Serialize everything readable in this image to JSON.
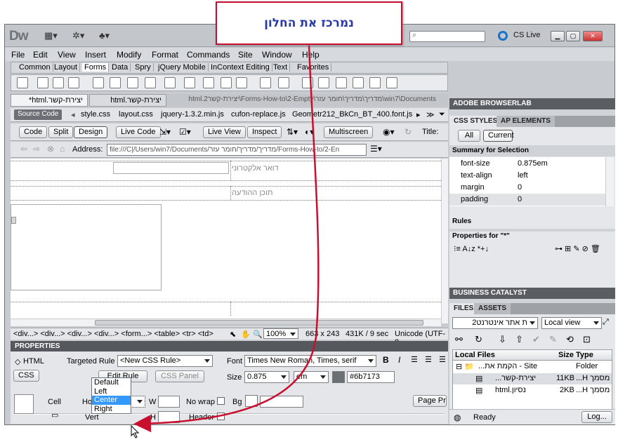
{
  "callout": {
    "text": "נמרכז את החלון"
  },
  "app": {
    "logo": "Dw",
    "cs_live": "CS Live"
  },
  "menu": [
    "File",
    "Edit",
    "View",
    "Insert",
    "Modify",
    "Format",
    "Commands",
    "Site",
    "Window",
    "Help"
  ],
  "insert_tabs": [
    {
      "label": "Common",
      "active": false
    },
    {
      "label": "Layout",
      "active": false
    },
    {
      "label": "Forms",
      "active": true
    },
    {
      "label": "Data",
      "active": false
    },
    {
      "label": "Spry",
      "active": false
    },
    {
      "label": "jQuery Mobile",
      "active": false
    },
    {
      "label": "InContext Editing",
      "active": false
    },
    {
      "label": "Text",
      "active": false
    },
    {
      "label": "Favorites",
      "active": false
    }
  ],
  "doc_tabs": [
    {
      "label": "יצירת-קשר.html*",
      "active": true
    },
    {
      "label": "יצירת-קשר.html",
      "active": false
    }
  ],
  "doc_path": "win7\\Documents\\מדריך\\מדריך\\חומר עזר\\Forms-How-to\\2-Empty\\יצירת-קשר2.html",
  "related_files": {
    "source_code": "Source Code",
    "files": [
      "style.css",
      "layout.css",
      "jquery-1.3.2.min.js",
      "cufon-replace.js",
      "Geometr212_BkCn_BT_400.font.js"
    ]
  },
  "doc_toolbar": {
    "code": "Code",
    "split": "Split",
    "design": "Design",
    "live_code": "Live Code",
    "live_view": "Live View",
    "inspect": "Inspect",
    "multiscreen": "Multiscreen",
    "title_label": "Title:"
  },
  "address": {
    "label": "Address:",
    "value": "file:///C|/Users/win7/Documents/מדריך/מדריך/חומר עזר/Forms-How-to/2-En"
  },
  "design": {
    "email_label": "דואר אלקטרוני",
    "message_label": "תוכן ההודעה"
  },
  "status": {
    "tags": "<div...> <div...> <div...> <div...> <form...> <table> <tr> <td>",
    "zoom": "100%",
    "size": "663 x 243",
    "file": "431K / 9 sec",
    "encoding": "Unicode (UTF-8"
  },
  "properties": {
    "header": "PROPERTIES",
    "html_btn": "HTML",
    "css_btn": "CSS",
    "targeted_rule_label": "Targeted Rule",
    "targeted_rule_value": "<New CSS Rule>",
    "edit_rule": "Edit Rule",
    "css_panel": "CSS Panel",
    "font_label": "Font",
    "font_value": "Times New Roman, Times, serif",
    "size_label": "Size",
    "size_value": "0.875",
    "unit_value": "em",
    "color_value": "#6b7173",
    "cell_label": "Cell",
    "horz_label": "Horz",
    "horz_value": "Left",
    "vert_label": "Vert",
    "w_label": "W",
    "h_label": "H",
    "nowrap_label": "No wrap",
    "bg_label": "Bg",
    "header_label": "Header",
    "page_props": "Page Properties...",
    "horz_options": [
      "Default",
      "Left",
      "Center",
      "Right"
    ],
    "horz_highlight": "Center"
  },
  "right": {
    "browserlab": "ADOBE BROWSERLAB",
    "css_styles_tab": "CSS STYLES",
    "ap_tab": "AP ELEMENTS",
    "all_btn": "All",
    "current_btn": "Current",
    "summary_label": "Summary for Selection",
    "summary": [
      {
        "prop": "font-size",
        "value": "0.875em"
      },
      {
        "prop": "text-align",
        "value": "left"
      },
      {
        "prop": "margin",
        "value": "0"
      },
      {
        "prop": "padding",
        "value": "0"
      }
    ],
    "rules_label": "Rules",
    "properties_for": "Properties for \"*\"",
    "business_catalyst": "BUSINESS CATALYST",
    "files_tab": "FILES",
    "assets_tab": "ASSETS",
    "site_value": "ת אתר אינטרנט2",
    "view_value": "Local view",
    "cols": {
      "local": "Local Files",
      "size": "Size",
      "type": "Type"
    },
    "rows": [
      {
        "name": "Site - הקמת את...",
        "size": "",
        "type": "Folder"
      },
      {
        "name": "יצירת-קשר...",
        "size": "11KB",
        "type": "מסמך H..."
      },
      {
        "name": "נסיון.html",
        "size": "2KB",
        "type": "מסמך H..."
      }
    ],
    "ready": "Ready",
    "log": "Log..."
  }
}
